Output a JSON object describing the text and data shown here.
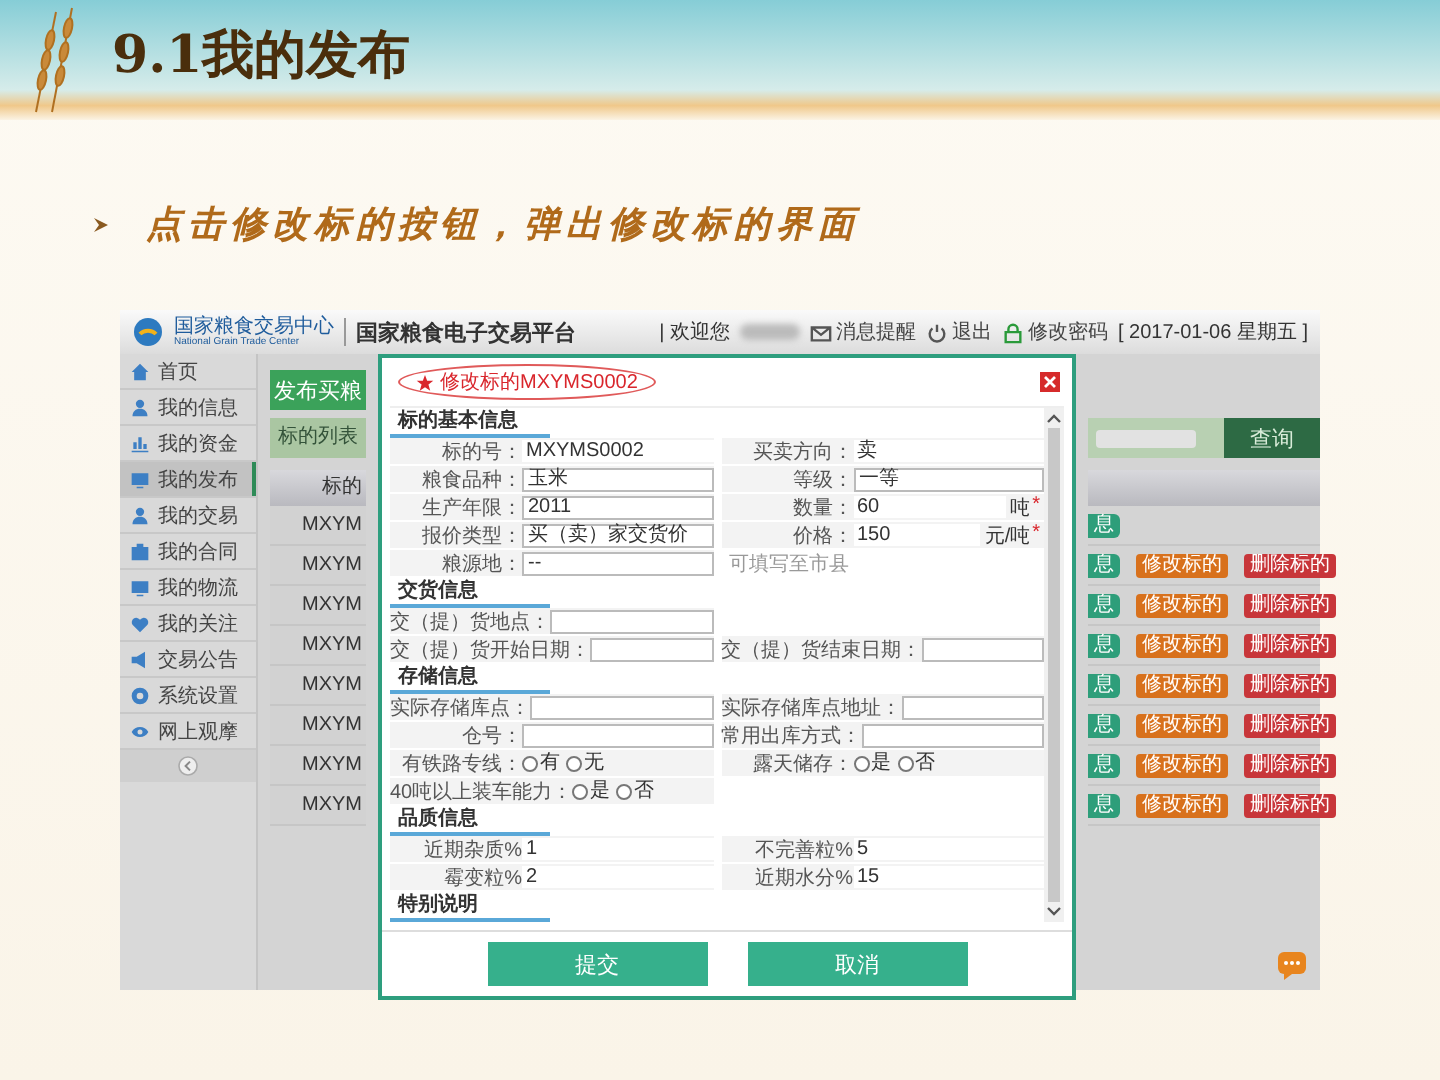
{
  "slide": {
    "title": "9.1我的发布",
    "bullet": "点击修改标的按钮，弹出修改标的界面"
  },
  "app": {
    "header": {
      "logo_name": "国家粮食交易中心",
      "logo_subtitle": "National Grain Trade Center",
      "platform": "国家粮食电子交易平台",
      "welcome": "| 欢迎您",
      "links": [
        {
          "label": "消息提醒",
          "kind": "message"
        },
        {
          "label": "退出",
          "kind": "logout"
        },
        {
          "label": "修改密码",
          "kind": "password"
        }
      ],
      "date": "[ 2017-01-06 星期五 ]"
    },
    "sidebar": {
      "items": [
        {
          "label": "首页",
          "selected": false
        },
        {
          "label": "我的信息",
          "selected": false
        },
        {
          "label": "我的资金",
          "selected": false
        },
        {
          "label": "我的发布",
          "selected": true
        },
        {
          "label": "我的交易",
          "selected": false
        },
        {
          "label": "我的合同",
          "selected": false
        },
        {
          "label": "我的物流",
          "selected": false
        },
        {
          "label": "我的关注",
          "selected": false
        },
        {
          "label": "交易公告",
          "selected": false
        },
        {
          "label": "系统设置",
          "selected": false
        },
        {
          "label": "网上观摩",
          "selected": false
        }
      ]
    },
    "content": {
      "publish_button": "发布买粮",
      "list_tab": "标的列表",
      "search_button": "查询",
      "table": {
        "column_1": "标的",
        "rows": [
          {
            "column_1": "MXYM",
            "actions": [
              {
                "label": "息",
                "kind": "view"
              }
            ]
          },
          {
            "column_1": "MXYM",
            "actions": [
              {
                "label": "息",
                "kind": "view"
              },
              {
                "label": "修改标的",
                "kind": "edit"
              },
              {
                "label": "删除标的",
                "kind": "delete"
              }
            ]
          },
          {
            "column_1": "MXYM",
            "actions": [
              {
                "label": "息",
                "kind": "view"
              },
              {
                "label": "修改标的",
                "kind": "edit"
              },
              {
                "label": "删除标的",
                "kind": "delete"
              }
            ]
          },
          {
            "column_1": "MXYM",
            "actions": [
              {
                "label": "息",
                "kind": "view"
              },
              {
                "label": "修改标的",
                "kind": "edit"
              },
              {
                "label": "删除标的",
                "kind": "delete"
              }
            ]
          },
          {
            "column_1": "MXYM",
            "actions": [
              {
                "label": "息",
                "kind": "view"
              },
              {
                "label": "修改标的",
                "kind": "edit"
              },
              {
                "label": "删除标的",
                "kind": "delete"
              }
            ]
          },
          {
            "column_1": "MXYM",
            "actions": [
              {
                "label": "息",
                "kind": "view"
              },
              {
                "label": "修改标的",
                "kind": "edit"
              },
              {
                "label": "删除标的",
                "kind": "delete"
              }
            ]
          },
          {
            "column_1": "MXYM",
            "actions": [
              {
                "label": "息",
                "kind": "view"
              },
              {
                "label": "修改标的",
                "kind": "edit"
              },
              {
                "label": "删除标的",
                "kind": "delete"
              }
            ]
          },
          {
            "column_1": "MXYM",
            "actions": [
              {
                "label": "息",
                "kind": "view"
              },
              {
                "label": "修改标的",
                "kind": "edit"
              },
              {
                "label": "删除标的",
                "kind": "delete"
              }
            ]
          }
        ]
      }
    },
    "dialog": {
      "title": "修改标的MXYMS0002",
      "sections": [
        {
          "title": "标的基本信息",
          "rows": [
            [
              {
                "label": "标的号：",
                "value": "MXYMS0002",
                "kind": "text"
              },
              {
                "label": "买卖方向：",
                "value": "卖",
                "kind": "text"
              }
            ],
            [
              {
                "label": "粮食品种：",
                "value": "玉米",
                "kind": "input"
              },
              {
                "label": "等级：",
                "value": "一等",
                "kind": "input"
              }
            ],
            [
              {
                "label": "生产年限：",
                "value": "2011",
                "kind": "input"
              },
              {
                "label": "数量：",
                "value": "60",
                "kind": "text",
                "unit": "吨",
                "mark": "*"
              }
            ],
            [
              {
                "label": "报价类型：",
                "value": "买（卖）家交货价",
                "kind": "input"
              },
              {
                "label": "价格：",
                "value": "150",
                "kind": "text",
                "unit": "元/吨",
                "mark": "*"
              }
            ],
            [
              {
                "label": "粮源地：",
                "value": "--",
                "kind": "input",
                "hint": "可填写至市县"
              }
            ]
          ]
        },
        {
          "title": "交货信息",
          "rows": [
            [
              {
                "label": "交（提）货地点：",
                "kind": "input"
              }
            ],
            [
              {
                "label": "交（提）货开始日期：",
                "kind": "input"
              },
              {
                "label": "交（提）货结束日期：",
                "kind": "input"
              }
            ]
          ]
        },
        {
          "title": "存储信息",
          "rows": [
            [
              {
                "label": "实际存储库点：",
                "kind": "input"
              },
              {
                "label": "实际存储库点地址：",
                "kind": "input"
              }
            ],
            [
              {
                "label": "仓号：",
                "kind": "input"
              },
              {
                "label": "常用出库方式：",
                "kind": "input"
              }
            ],
            [
              {
                "label": "有铁路专线：",
                "kind": "radio",
                "options": [
                  {
                    "label": "有",
                    "selected": false
                  },
                  {
                    "label": "无",
                    "selected": false
                  }
                ]
              },
              {
                "label": "露天储存：",
                "kind": "radio",
                "options": [
                  {
                    "label": "是",
                    "selected": false
                  },
                  {
                    "label": "否",
                    "selected": false
                  }
                ]
              }
            ],
            [
              {
                "label": "40吨以上装车能力：",
                "kind": "radio",
                "options": [
                  {
                    "label": "是",
                    "selected": false
                  },
                  {
                    "label": "否",
                    "selected": false
                  }
                ]
              }
            ]
          ]
        },
        {
          "title": "品质信息",
          "rows": [
            [
              {
                "label": "近期杂质%",
                "value": "1",
                "kind": "text"
              },
              {
                "label": "不完善粒%",
                "value": "5",
                "kind": "text"
              }
            ],
            [
              {
                "label": "霉变粒%",
                "value": "2",
                "kind": "text"
              },
              {
                "label": "近期水分%",
                "value": "15",
                "kind": "text"
              }
            ]
          ]
        },
        {
          "title": "特别说明"
        }
      ],
      "buttons": [
        "提交",
        "取消"
      ]
    }
  }
}
